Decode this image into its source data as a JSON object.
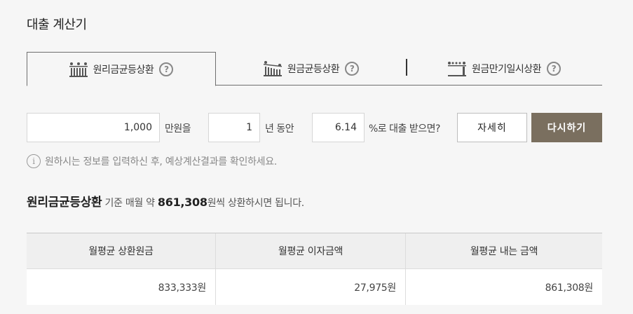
{
  "page": {
    "title": "대출 계산기"
  },
  "tabs": [
    {
      "label": "원리금균등상환",
      "icon": "equal-payment-bars-icon",
      "active": true
    },
    {
      "label": "원금균등상환",
      "icon": "declining-bars-icon",
      "active": false
    },
    {
      "label": "원금만기일시상환",
      "icon": "bullet-repayment-icon",
      "active": false
    }
  ],
  "help_glyph": "?",
  "form": {
    "amount_value": "1,000",
    "amount_unit": "만원을",
    "years_value": "1",
    "years_unit": "년 동안",
    "rate_value": "6.14",
    "rate_unit": "%로 대출 받으면?",
    "detail_button": "자세히",
    "retry_button": "다시하기"
  },
  "notice": {
    "icon_glyph": "i",
    "text": "원하시는 정보를 입력하신 후, 예상계산결과를 확인하세요."
  },
  "summary": {
    "method": "원리금균등상환",
    "prefix": " 기준 매월 약 ",
    "amount": "861,308",
    "suffix": "원씩 상환하시면 됩니다."
  },
  "table": {
    "headers": [
      "월평균 상환원금",
      "월평균 이자금액",
      "월평균 내는 금액"
    ],
    "values": [
      "833,333원",
      "27,975원",
      "861,308원"
    ]
  },
  "colors": {
    "accent_button": "#7a6f5f",
    "background": "#f6f6f6"
  }
}
